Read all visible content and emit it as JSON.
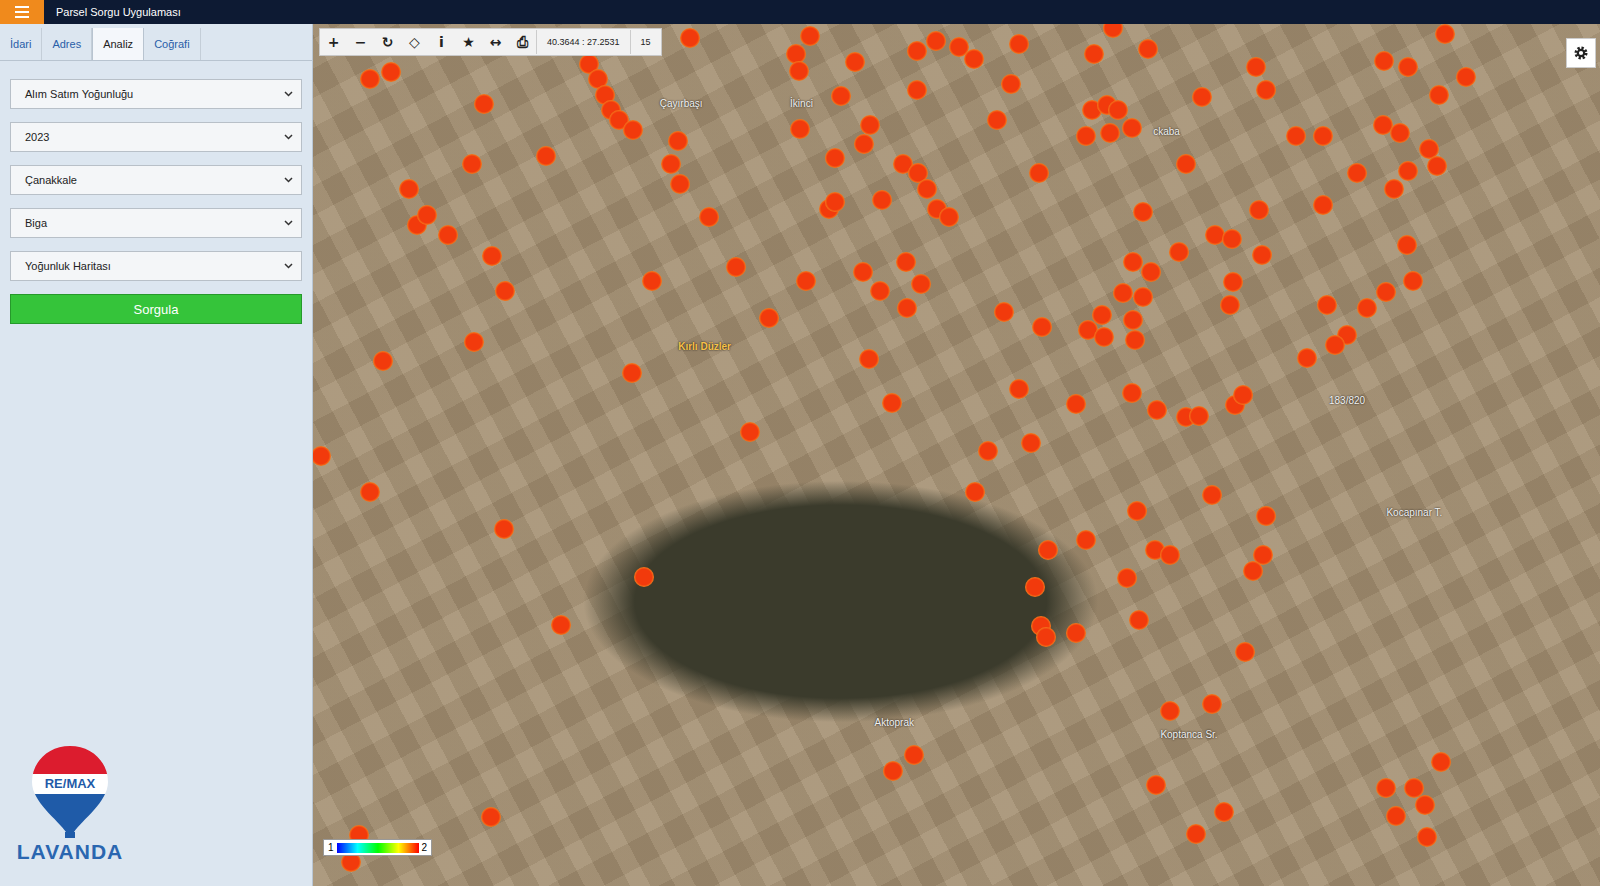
{
  "top_bar": {
    "title": "Parsel Sorgu Uygulaması"
  },
  "tabs": [
    {
      "label": "İdari",
      "selected": false
    },
    {
      "label": "Adres",
      "selected": false
    },
    {
      "label": "Analiz",
      "selected": true
    },
    {
      "label": "Coğrafi",
      "selected": false
    }
  ],
  "filters": [
    {
      "value": "Alım Satım Yoğunluğu"
    },
    {
      "value": "2023"
    },
    {
      "value": "Çanakkale"
    },
    {
      "value": "Biga"
    },
    {
      "value": "Yoğunluk Haritası"
    }
  ],
  "query_button": "Sorgula",
  "logo": {
    "brand": "RE/MAX",
    "name": "LAVANDA"
  },
  "map": {
    "tools": [
      "+",
      "−",
      "↻",
      "◇",
      "i",
      "★",
      "↔",
      "⎙"
    ],
    "coordinates": "40.3644 : 27.2531",
    "zoom": "15",
    "labels": [
      {
        "text": "Çayırbaşı",
        "highlight": false
      },
      {
        "text": "İkinci",
        "highlight": false
      },
      {
        "text": "ckaba",
        "highlight": false
      },
      {
        "text": "Kırlı Düzler",
        "highlight": true
      },
      {
        "text": "183/820",
        "highlight": false
      },
      {
        "text": "Kocapınar T.",
        "highlight": false
      },
      {
        "text": "Aktoprak",
        "highlight": false
      },
      {
        "text": "Koptanca Sr.",
        "highlight": false
      }
    ],
    "legend": {
      "min": "1",
      "max": "2"
    }
  }
}
